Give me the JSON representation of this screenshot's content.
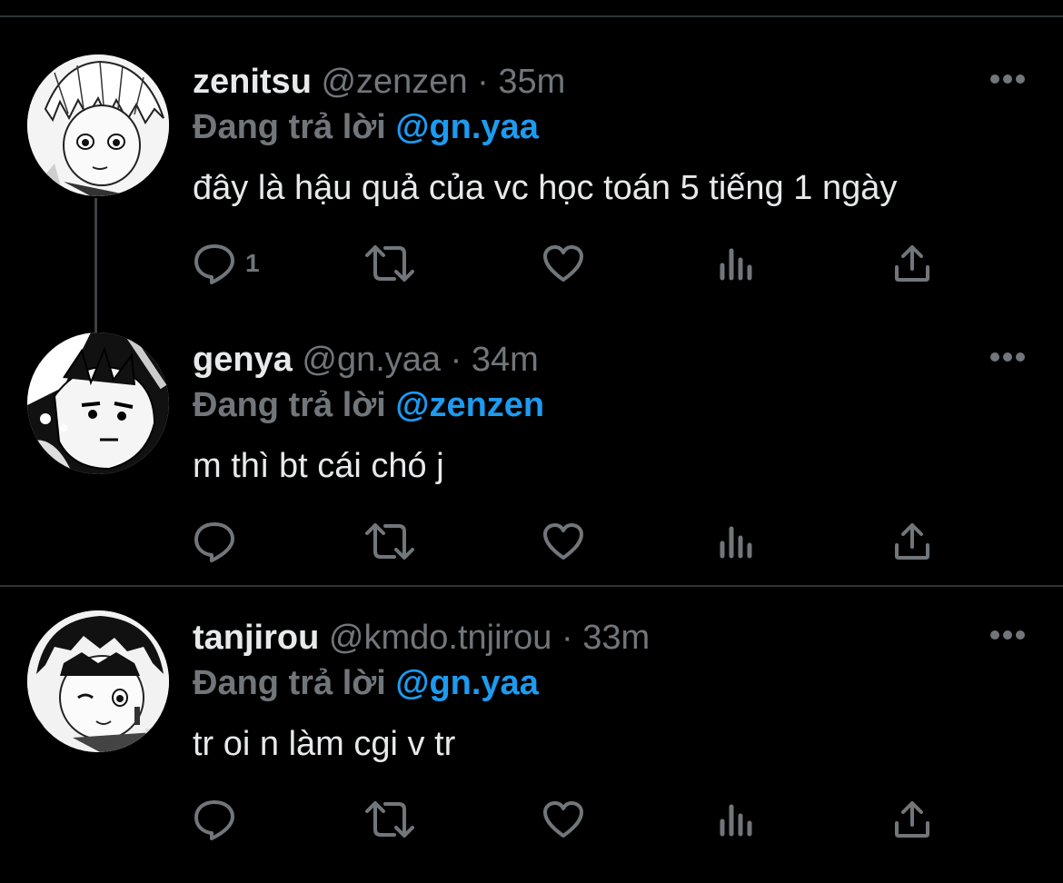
{
  "tweets": [
    {
      "display_name": "zenitsu",
      "handle": "@zenzen",
      "separator": "·",
      "time": "35m",
      "reply_prefix": "Đang trả lời",
      "reply_handle": "@gn.yaa",
      "text": "đây là hậu quả của vc học toán 5 tiếng 1 ngày",
      "reply_count": "1",
      "avatar": "zenitsu-avatar"
    },
    {
      "display_name": "genya",
      "handle": "@gn.yaa",
      "separator": "·",
      "time": "34m",
      "reply_prefix": "Đang trả lời",
      "reply_handle": "@zenzen",
      "text": "m thì bt cái chó j",
      "reply_count": "",
      "avatar": "genya-avatar"
    },
    {
      "display_name": "tanjirou",
      "handle": "@kmdo.tnjirou",
      "separator": "·",
      "time": "33m",
      "reply_prefix": "Đang trả lời",
      "reply_handle": "@gn.yaa",
      "text": "tr oi n làm cgi v tr",
      "reply_count": "",
      "avatar": "tanjirou-avatar"
    }
  ],
  "icons": [
    "reply-icon",
    "retweet-icon",
    "like-icon",
    "views-icon",
    "share-icon",
    "more-icon"
  ],
  "colors": {
    "background": "#000000",
    "text": "#e7e9ea",
    "secondary": "#71767b",
    "accent": "#1d9bf0",
    "divider": "#2f3336"
  }
}
